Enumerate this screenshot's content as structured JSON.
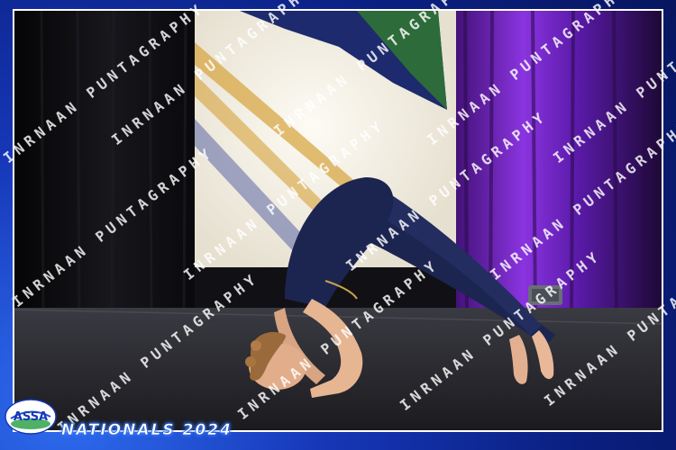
{
  "photo": {
    "subject": "dancer-in-backbend",
    "colors": {
      "border": "#1637b8",
      "leotard": "#1c2550",
      "curtain_purple": "#7a2ad0",
      "stage_floor": "#2b2b30",
      "backdrop": "#f3efe4"
    }
  },
  "overlay": {
    "event_title": "NATIONALS 2024",
    "logo_text": "ASSA",
    "watermark_text": "INRNAAN PUNTAGRAPHY"
  }
}
